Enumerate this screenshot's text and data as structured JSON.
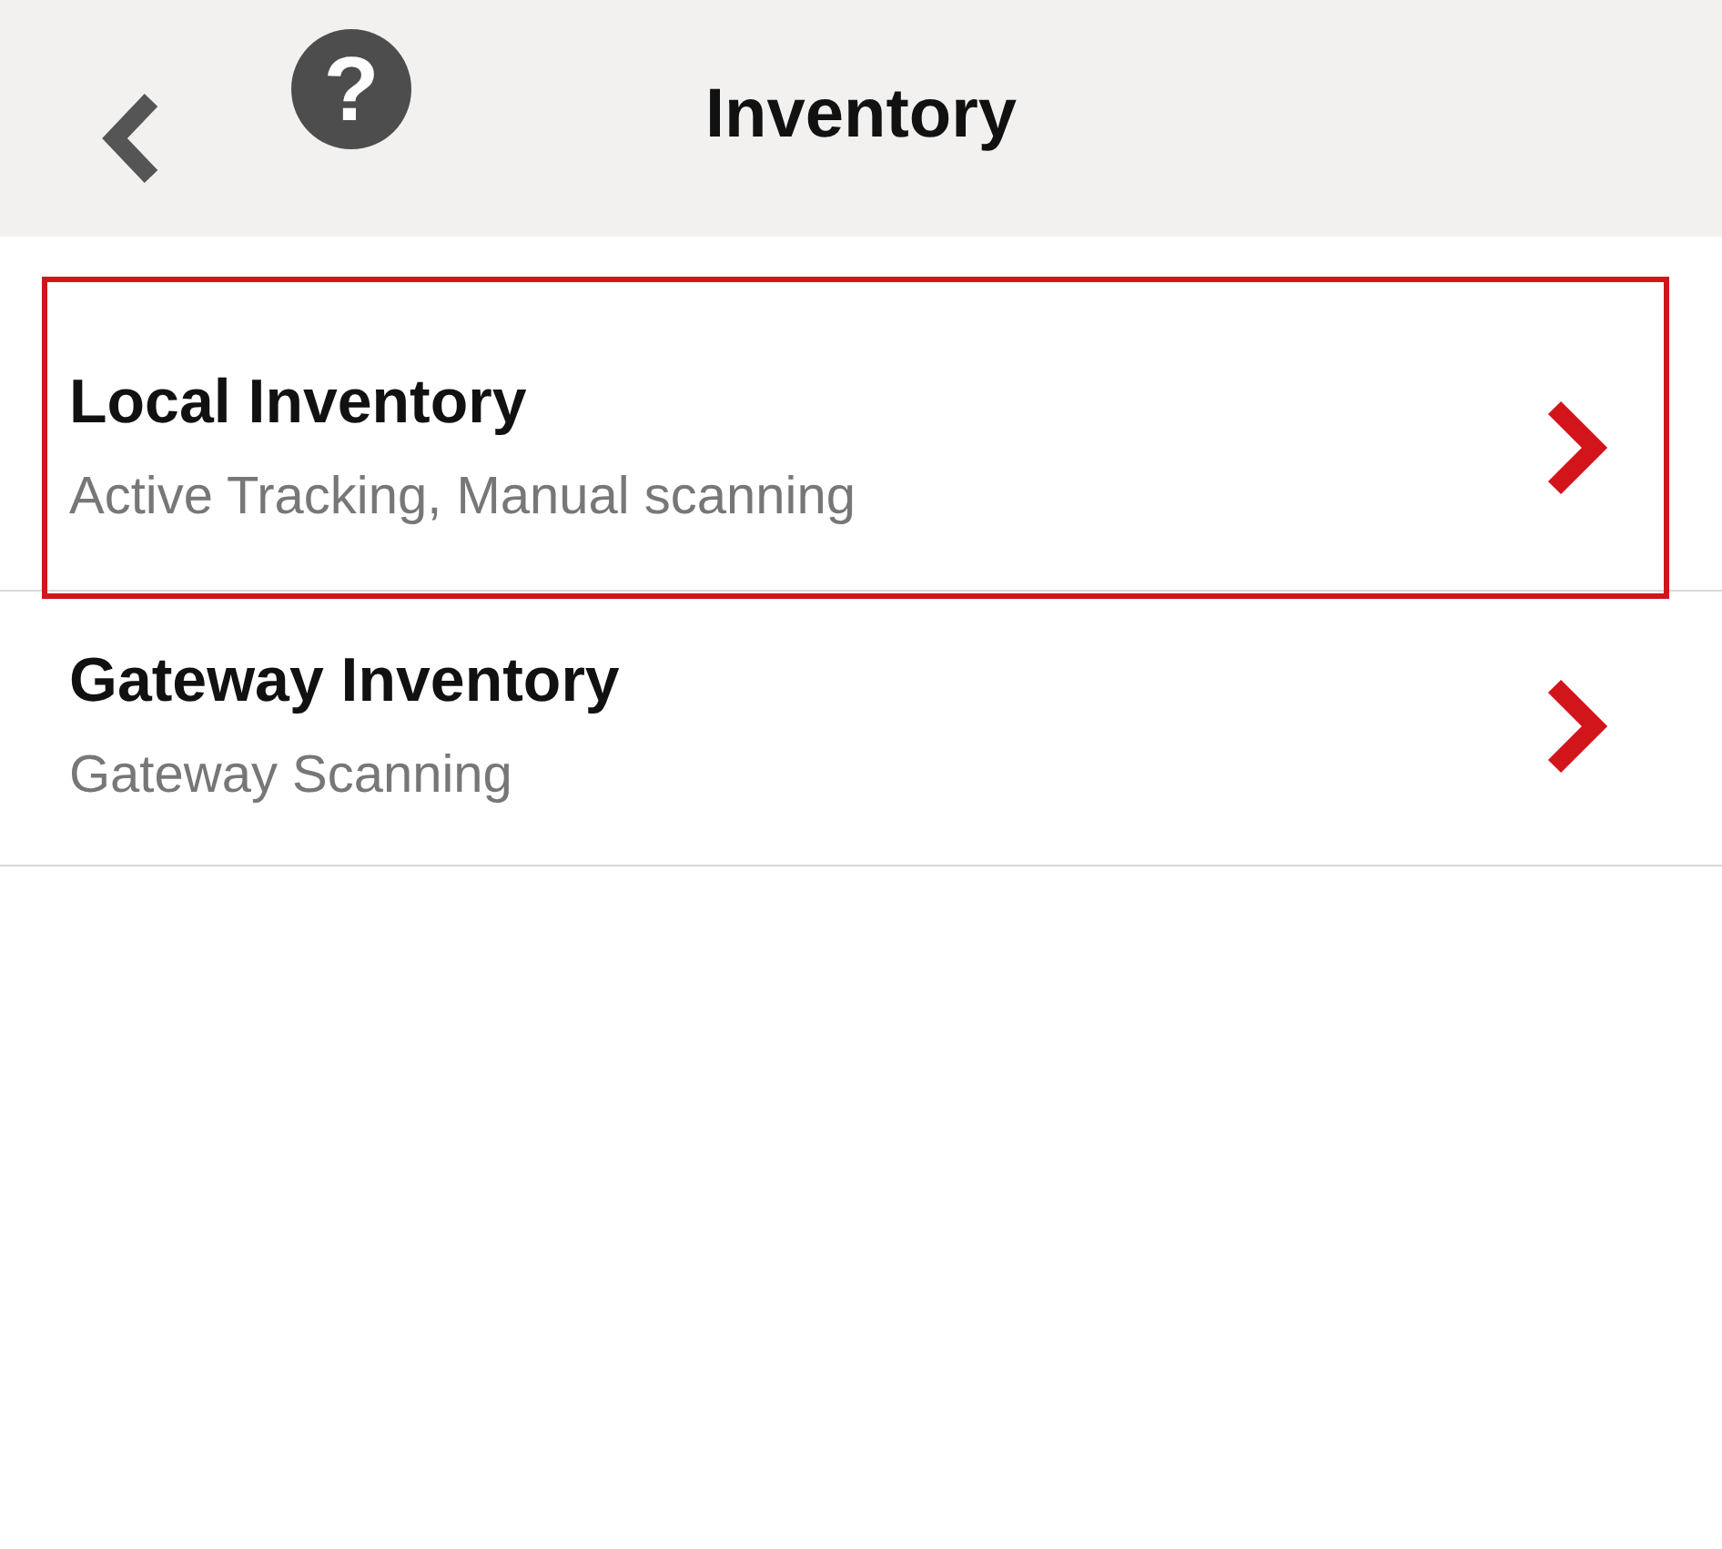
{
  "header": {
    "title": "Inventory",
    "help_label": "?"
  },
  "items": [
    {
      "title": "Local Inventory",
      "subtitle": "Active Tracking, Manual scanning",
      "selected": true
    },
    {
      "title": "Gateway Inventory",
      "subtitle": "Gateway Scanning",
      "selected": false
    }
  ]
}
